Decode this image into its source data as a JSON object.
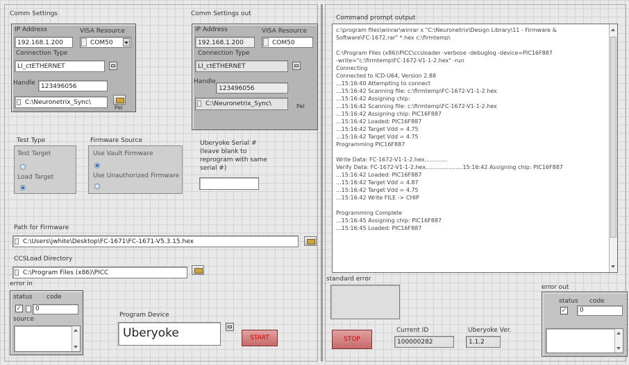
{
  "comm_settings": {
    "title": "Comm Settings",
    "ip_label": "IP Address",
    "ip_value": "192.168.1.200",
    "visa_label": "VISA Resource",
    "visa_value": "COM50",
    "conn_type_label": "Connection Type",
    "conn_type_value": "LI_ctETHERNET",
    "handle_label": "Handle",
    "handle_value": "123496056",
    "path_value": "C:\\Neuronetrix_Sync\\",
    "path_icon_label": "Pel"
  },
  "comm_settings_out": {
    "title": "Comm Settings out",
    "ip_label": "IP Address",
    "ip_value": "192.168.1.200",
    "visa_label": "VISA Resource",
    "visa_value": "COM50",
    "conn_type_label": "Connection Type",
    "conn_type_value": "LI_ctETHERNET",
    "handle_label": "Handle",
    "handle_value": "123496056",
    "path_value": "C:\\Neuronetrix_Sync\\",
    "path_icon_label": "Pel"
  },
  "test_type": {
    "title": "Test Type",
    "option1": "Test Target",
    "option2": "Load Target",
    "selected": 2
  },
  "firmware_source": {
    "title": "Firmware Source",
    "option1": "Use Vault Firmware",
    "option2": "Use Unauthorized Firmware",
    "selected": 1
  },
  "uberyoke_serial": {
    "label": "Uberyoke Serial #",
    "hint1": "(leave blank to",
    "hint2": "reprogram with same",
    "hint3": "serial #)",
    "value": ""
  },
  "path_firmware": {
    "label": "Path for Firmware",
    "value": "C:\\Users\\jwhite\\Desktop\\FC-1671\\FC-1671-V5.3.15.hex"
  },
  "ccsload_dir": {
    "label": "CCSLoad Directory",
    "value": "C:\\Program Files (x86)\\PICC"
  },
  "error_in": {
    "title": "error in",
    "status_label": "status",
    "code_label": "code",
    "code_value": "0",
    "source_label": "source"
  },
  "program_device": {
    "label": "Program Device",
    "value": "Uberyoke",
    "start_label": "START"
  },
  "command_prompt": {
    "title": "Command prompt output",
    "lines": [
      "c:\\program files\\winrar\\winrar x \"C:\\Neuronetrix\\Design Library\\11 - Firmware &",
      "Software\\FC-1672.rar\" *.hex c:\\firmtemp\\",
      "",
      "C:\\Program Files (x86)\\PICC\\ccsloader -verbose -debuglog -device=PIC16F887",
      "-write=\"c:\\firmtemp\\FC-1672-V1-1-2.hex\" -run",
      "Connecting",
      "Connected to ICD-U64, Version 2.88",
      "...15:16:40  Attempting to connect",
      "...15:16:42  Scanning file: c:\\firmtemp\\FC-1672-V1-1-2.hex",
      "...15:16:42  Assigning chip:",
      "...15:16:42  Scanning file: c:\\firmtemp\\FC-1672-V1-1-2.hex",
      "...15:16:42  Assigning chip: PIC16F887",
      "...15:16:42  Loaded: PIC16F887",
      "...15:16:42  Target Vdd = 4.75",
      "...15:16:42  Target Vdd = 4.75",
      "Programming PIC16F887",
      "",
      "Write Data: FC-1672-V1-1-2.hex.............",
      "Verify Data: FC-1672-V1-1-2.hex.....................15:16:42  Assigning chip: PIC16F887",
      "...15:16:42  Loaded: PIC16F887",
      "...15:16:42  Target Vdd = 4.87",
      "...15:16:42  Target Vdd = 4.75",
      "...15:16:42  Write FILE -> CHIP",
      "",
      "Programming Complete",
      "...15:16:45  Assigning chip: PIC16F887",
      "...15:16:45  Loaded: PIC16F887"
    ]
  },
  "standard_error": {
    "label": "standard error"
  },
  "stop_label": "STOP",
  "current_id": {
    "label": "Current ID",
    "value": "100000282"
  },
  "uberyoke_ver": {
    "label": "Uberyoke Ver.",
    "value": "1.1.2"
  },
  "error_out": {
    "title": "error out",
    "status_label": "status",
    "code_label": "code",
    "code_value": "0"
  },
  "colors": {
    "start_text": "#cc0000",
    "check_green": "#2a8a2a",
    "cluster_grey": "#b5b5b5"
  }
}
